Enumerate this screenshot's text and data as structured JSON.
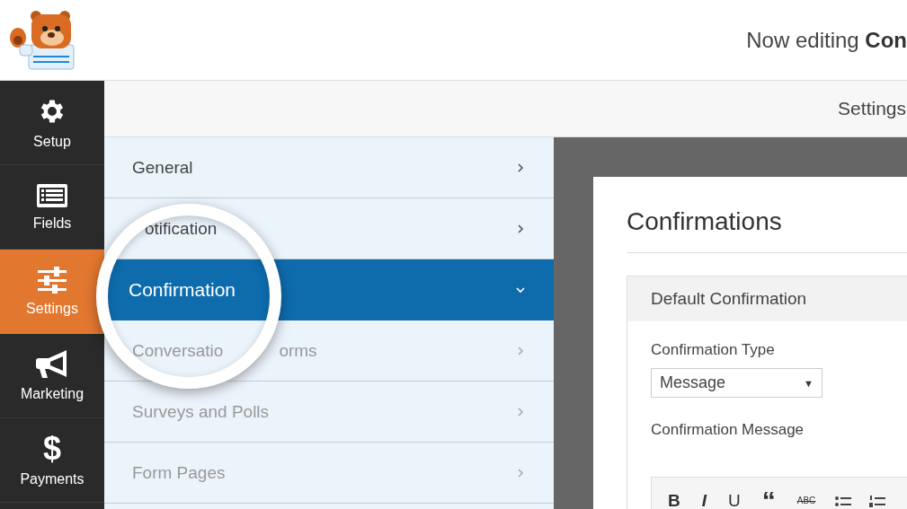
{
  "header": {
    "title": "Now editing **Con**"
  },
  "sidebar": {
    "items": [
      {
        "label": "Setup",
        "selected": false
      },
      {
        "label": "Fields",
        "selected": false
      },
      {
        "label": "Settings",
        "selected": true
      },
      {
        "label": "Marketing",
        "selected": false
      },
      {
        "label": "Payments",
        "selected": false,
        "icon_char": "$"
      }
    ]
  },
  "toolbar": {
    "title": "Settings"
  },
  "settings_menu": {
    "items": [
      {
        "label_parts": [
          "General"
        ],
        "selected": false,
        "disabled": false
      },
      {
        "label_parts": [
          "otification"
        ],
        "selected": false,
        "disabled": false
      },
      {
        "label_parts": [
          "Confirmation"
        ],
        "selected": true,
        "disabled": false
      },
      {
        "label_parts": [
          "Conversatio",
          "orms"
        ],
        "selected": false,
        "disabled": true
      },
      {
        "label_parts": [
          "Surveys and Polls"
        ],
        "selected": false,
        "disabled": true
      },
      {
        "label_parts": [
          "Form Pages"
        ],
        "selected": false,
        "disabled": true
      }
    ]
  },
  "panel": {
    "title": "Confirmations",
    "section_title": "Default Confirmation",
    "type_label": "Confirmation Type",
    "type_value": "Message",
    "type_caret": "▼",
    "message_label": "Confirmation Message",
    "editor_buttons": [
      {
        "kind": "bold",
        "label": "B"
      },
      {
        "kind": "italic",
        "label": "I"
      },
      {
        "kind": "underline",
        "label": "U"
      },
      {
        "kind": "quote",
        "label": "“"
      },
      {
        "kind": "strike",
        "label": "ABC"
      },
      {
        "kind": "bullets"
      },
      {
        "kind": "numbers"
      }
    ]
  }
}
